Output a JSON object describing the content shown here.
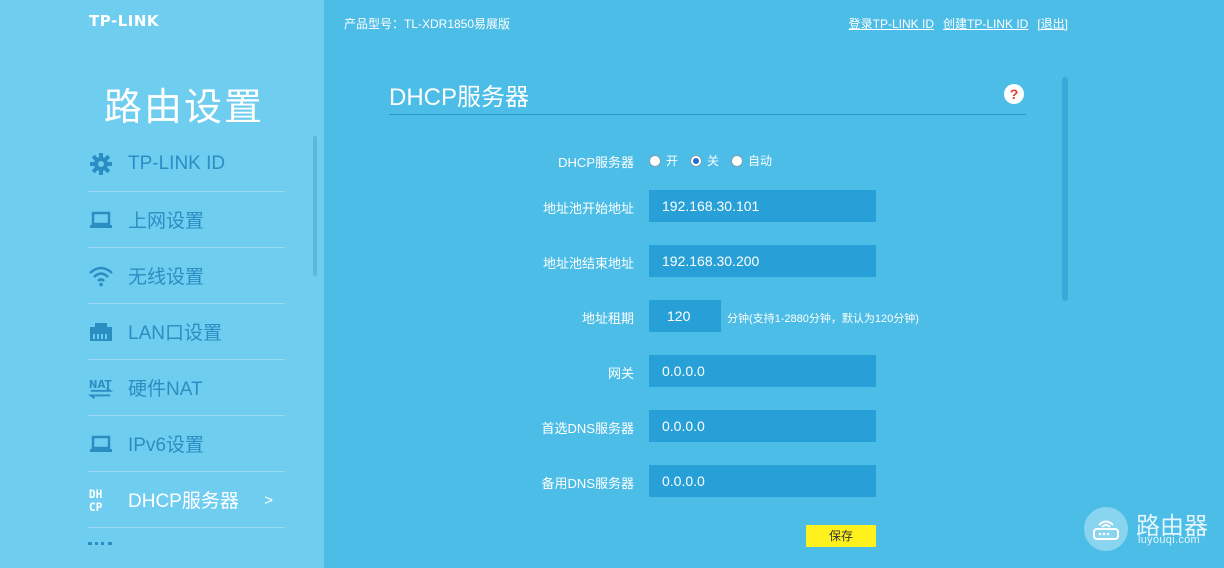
{
  "brand": {
    "logo": "TP-LINK"
  },
  "header": {
    "product_label": "产品型号：TL-XDR1850易展版",
    "links": [
      "登录TP-LINK ID",
      "创建TP-LINK ID",
      "[退出]"
    ]
  },
  "sidebar": {
    "title": "路由设置",
    "items": [
      {
        "label": "TP-LINK ID",
        "icon": "gear-icon"
      },
      {
        "label": "上网设置",
        "icon": "laptop-icon"
      },
      {
        "label": "无线设置",
        "icon": "wifi-icon"
      },
      {
        "label": "LAN口设置",
        "icon": "lan-port-icon"
      },
      {
        "label": "硬件NAT",
        "icon": "nat-icon"
      },
      {
        "label": "IPv6设置",
        "icon": "laptop-icon"
      },
      {
        "label": "DHCP服务器",
        "icon": "dhcp-icon",
        "active": true,
        "arrow": ">"
      }
    ],
    "nat_icon_text": "NAT",
    "dhcp_icon_text": [
      "DH",
      "CP"
    ]
  },
  "main": {
    "title": "DHCP服务器",
    "help_label": "?",
    "dhcp_server": {
      "label": "DHCP服务器",
      "options": [
        "开",
        "关",
        "自动"
      ],
      "selected": "关"
    },
    "pool_start": {
      "label": "地址池开始地址",
      "value": "192.168.30.101"
    },
    "pool_end": {
      "label": "地址池结束地址",
      "value": "192.168.30.200"
    },
    "lease": {
      "label": "地址租期",
      "value": "120",
      "hint": "分钟(支持1-2880分钟，默认为120分钟)"
    },
    "gateway": {
      "label": "网关",
      "value": "0.0.0.0"
    },
    "dns_primary": {
      "label": "首选DNS服务器",
      "value": "0.0.0.0"
    },
    "dns_secondary": {
      "label": "备用DNS服务器",
      "value": "0.0.0.0"
    },
    "save_label": "保存"
  },
  "watermark": {
    "title": "路由器",
    "subtitle": "luyouqi.com"
  },
  "colors": {
    "background": "#4bbde6",
    "sidebar": "#6fcdf0",
    "menu_text": "#2a8ec2",
    "input_bg": "#27a0d8",
    "save_button": "#fff21c",
    "help_icon": "#e0402e"
  }
}
